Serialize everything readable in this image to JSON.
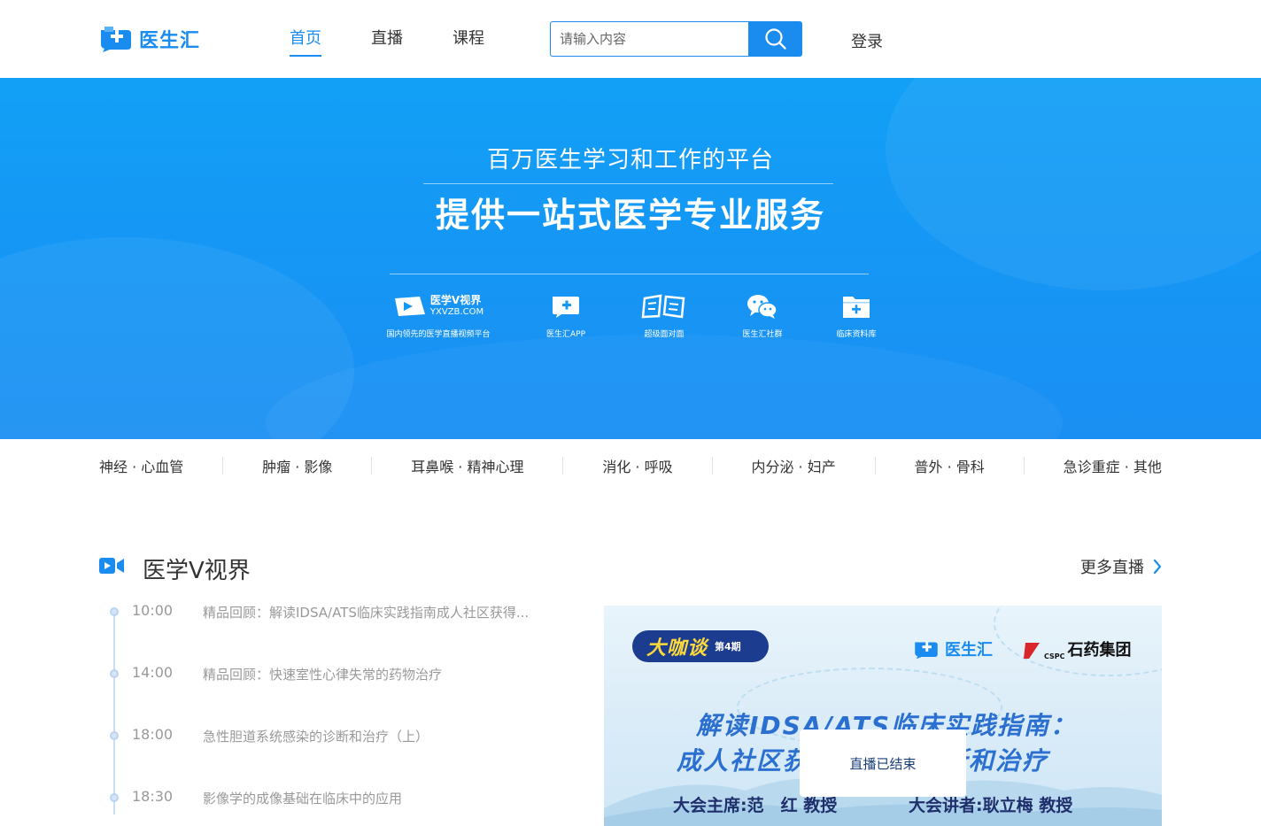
{
  "header": {
    "logo_text": "医生汇",
    "nav": [
      {
        "label": "首页",
        "active": true
      },
      {
        "label": "直播",
        "active": false
      },
      {
        "label": "课程",
        "active": false
      }
    ],
    "search_placeholder": "请输入内容",
    "login_label": "登录"
  },
  "banner": {
    "subtitle": "百万医生学习和工作的平台",
    "title": "提供一站式医学专业服务",
    "services": {
      "yxvzb": {
        "name": "医学V视界",
        "url": "YXVZB.COM",
        "label": "国内领先的医学直播视频平台"
      },
      "app": {
        "label": "医生汇APP"
      },
      "face": {
        "label": "超级面对面"
      },
      "community": {
        "label": "医生汇社群"
      },
      "library": {
        "label": "临床资料库"
      }
    }
  },
  "categories": [
    "神经 · 心血管",
    "肿瘤 · 影像",
    "耳鼻喉 · 精神心理",
    "消化 · 呼吸",
    "内分泌 · 妇产",
    "普外 · 骨科",
    "急诊重症 · 其他"
  ],
  "section": {
    "title": "医学V视界",
    "more_label": "更多直播",
    "schedule": [
      {
        "time": "10:00",
        "title": "精品回顾：解读IDSA/ATS临床实践指南成人社区获得..."
      },
      {
        "time": "14:00",
        "title": "精品回顾：快速室性心律失常的药物治疗"
      },
      {
        "time": "18:00",
        "title": "急性胆道系统感染的诊断和治疗（上）"
      },
      {
        "time": "18:30",
        "title": "影像学的成像基础在临床中的应用"
      }
    ]
  },
  "poster": {
    "badge_main": "大咖谈",
    "badge_sub": "第4期",
    "brand": "医生汇",
    "sponsor_en": "CSPC",
    "sponsor_cn": "石药集团",
    "headline1": "解读IDSA/ATS临床实践指南：",
    "headline2": "成人社区获得性肺炎诊断和治疗",
    "chair": "大会主席:范　红 教授",
    "speaker": "大会讲者:耿立梅 教授",
    "status": "直播已结束"
  },
  "colors": {
    "brand": "#1a8cf0",
    "banner": "#1597f5"
  }
}
